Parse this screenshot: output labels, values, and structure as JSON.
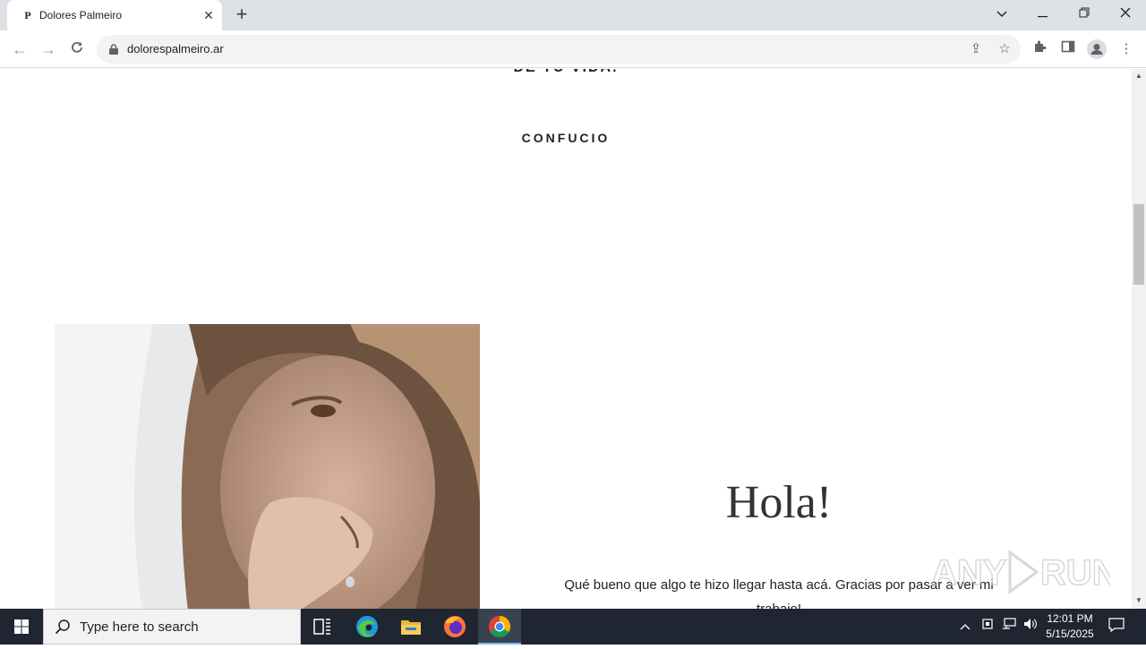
{
  "browser": {
    "tab_title": "Dolores Palmeiro",
    "tab_favicon_letter": "P",
    "url": "dolorespalmeiro.ar"
  },
  "page": {
    "quote_tail": "DE TU VIDA.",
    "quote_author": "CONFUCIO",
    "greeting": "Hola!",
    "intro_text": "Qué bueno que algo te hizo llegar hasta acá. Gracias por pasar a ver mi trabajo!",
    "watermark": "ANY RUN"
  },
  "taskbar": {
    "search_placeholder": "Type here to search",
    "time": "12:01 PM",
    "date": "5/15/2025"
  },
  "colors": {
    "tabstrip": "#dee1e6",
    "taskbar": "#1f2631",
    "accent": "#76b9ed"
  }
}
